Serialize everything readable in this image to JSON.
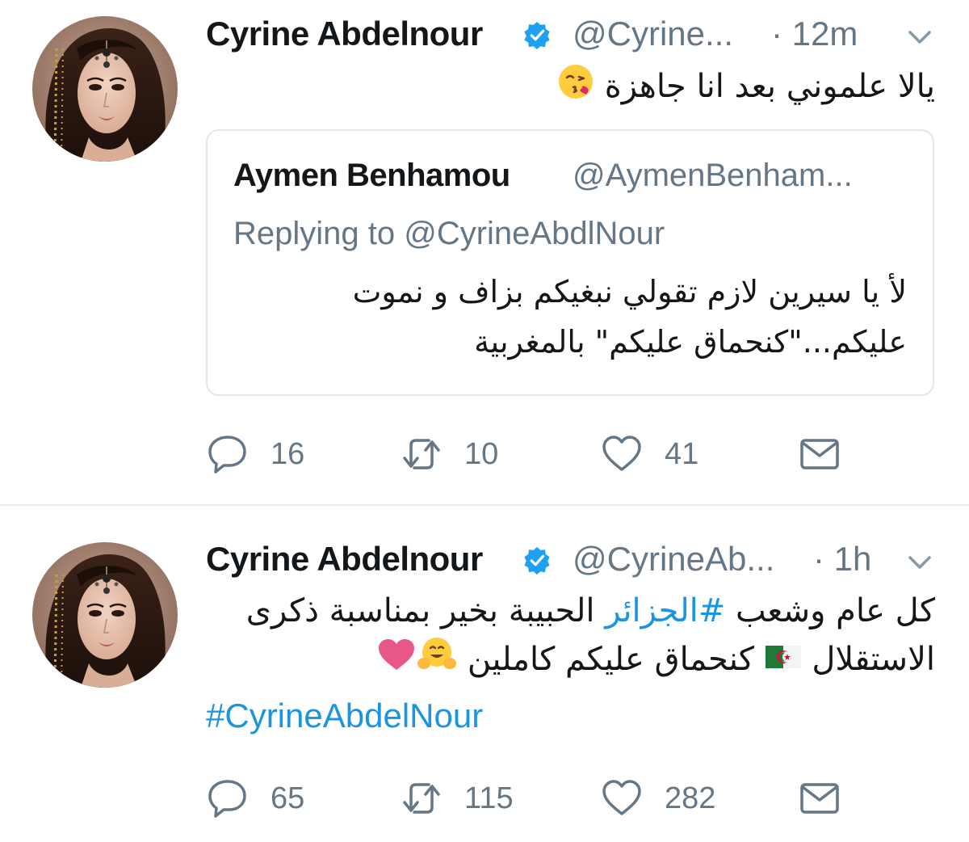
{
  "tweets": [
    {
      "author": {
        "name": "Cyrine Abdelnour",
        "handle": "@Cyrine...",
        "verified": true
      },
      "time": "· 12m",
      "text_main": "يالا علموني بعد انا جاهزة",
      "text_emoji": "face-throwing-kiss-emoji",
      "quoted": {
        "name": "Aymen Benhamou",
        "handle": "@AymenBenham...",
        "replying_to": "Replying to @CyrineAbdlNour",
        "text": "لأ يا سيرين لازم تقولي نبغيكم بزاف و نموت عليكم...\"كنحماق عليكم\" بالمغربية"
      },
      "stats": {
        "replies": "16",
        "retweets": "10",
        "likes": "41"
      }
    },
    {
      "author": {
        "name": "Cyrine Abdelnour",
        "handle": "@CyrineAb...",
        "verified": true
      },
      "time": "· 1h",
      "text_part1": "كل عام وشعب ",
      "text_hashtag": "#الجزائر",
      "text_part2": " الحبيبة بخير بمناسبة ذكرى الاستقلال ",
      "text_part3": " كنحماق عليكم كاملين ",
      "emojis": [
        "algeria-flag-emoji",
        "hugging-face-emoji",
        "pink-heart-emoji"
      ],
      "hashtag_line": "#CyrineAbdelNour",
      "stats": {
        "replies": "65",
        "retweets": "115",
        "likes": "282"
      }
    }
  ],
  "colors": {
    "text": "#14171a",
    "secondary": "#657786",
    "link": "#1b95e0",
    "border": "#e1e8ed",
    "divider": "#e6ecf0"
  },
  "icons": {
    "reply": "reply-bubble-icon",
    "retweet": "retweet-icon",
    "like": "heart-icon",
    "dm": "envelope-icon",
    "verified": "verified-badge-icon",
    "menu": "chevron-down-icon"
  }
}
